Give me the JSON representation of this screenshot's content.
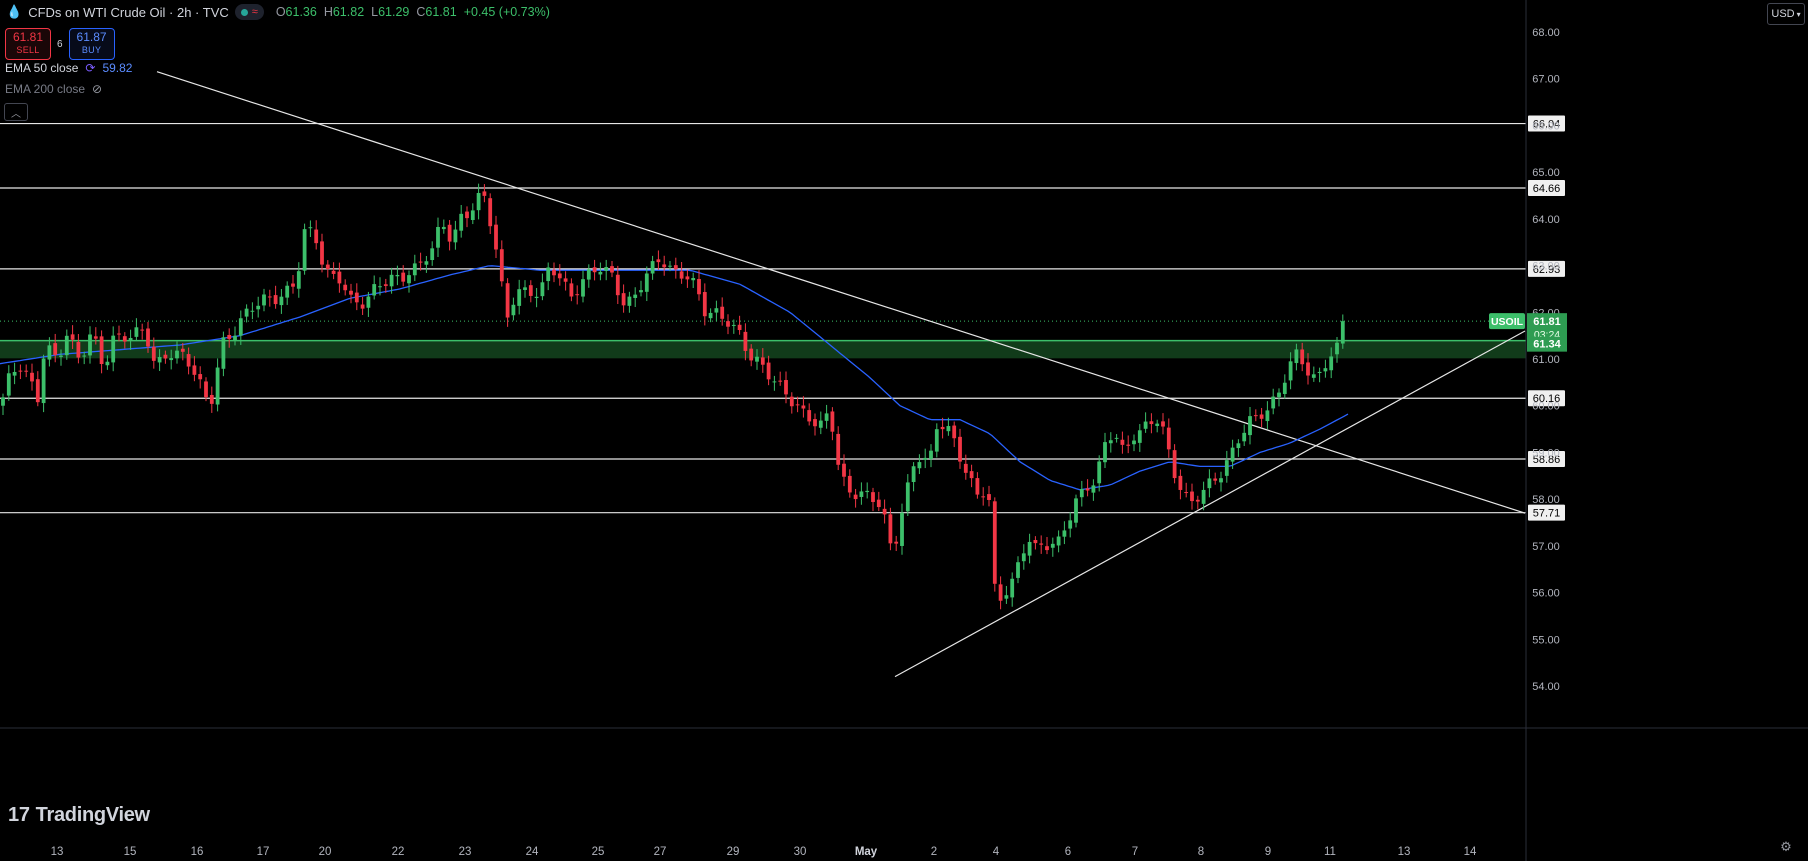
{
  "header": {
    "symbol_title": "CFDs on WTI Crude Oil · 2h · TVC",
    "ohlc": {
      "o_label": "O",
      "o": "61.36",
      "h_label": "H",
      "h": "61.82",
      "l_label": "L",
      "l": "61.29",
      "c_label": "C",
      "c": "61.81",
      "change": "+0.45 (+0.73%)"
    }
  },
  "trade": {
    "sell_price": "61.81",
    "sell_label": "SELL",
    "spread": "6",
    "buy_price": "61.87",
    "buy_label": "BUY"
  },
  "indicators": [
    {
      "name": "EMA 50 close",
      "value": "59.82"
    },
    {
      "name": "EMA 200 close"
    }
  ],
  "currency": "USD",
  "brand": "TradingView",
  "colors": {
    "up": "#3cbf6a",
    "down": "#f23645",
    "ema50": "#2962ff",
    "support_zone": "#1f6b2f",
    "lines": "#e6e6e6"
  },
  "chart_data": {
    "type": "candlestick",
    "symbol": "USOIL",
    "timeframe": "2h",
    "ylim": [
      53.8,
      68.5
    ],
    "price_axis_ticks": [
      "54.00",
      "55.00",
      "56.00",
      "57.00",
      "58.00",
      "59.00",
      "60.00",
      "61.00",
      "62.00",
      "63.00",
      "64.00",
      "65.00",
      "66.00",
      "67.00",
      "68.00"
    ],
    "x_labels": [
      "13",
      "15",
      "16",
      "17",
      "20",
      "22",
      "23",
      "24",
      "25",
      "27",
      "29",
      "30",
      "May",
      "2",
      "4",
      "6",
      "7",
      "8",
      "9",
      "11",
      "13",
      "14"
    ],
    "horizontal_levels": [
      "66.04",
      "64.66",
      "62.93",
      "60.16",
      "58.86",
      "57.71"
    ],
    "support_zone": {
      "from": 61.1,
      "to": 61.35,
      "label": "61.34"
    },
    "last_price": {
      "symbol": "USOIL",
      "price": "61.81",
      "countdown": "03:24"
    },
    "close_path": [
      [
        0,
        60.0
      ],
      [
        10,
        60.6
      ],
      [
        22,
        60.8
      ],
      [
        38,
        60.2
      ],
      [
        45,
        61.4
      ],
      [
        58,
        61.0
      ],
      [
        66,
        61.5
      ],
      [
        80,
        60.9
      ],
      [
        92,
        61.6
      ],
      [
        104,
        60.9
      ],
      [
        114,
        61.5
      ],
      [
        130,
        61.4
      ],
      [
        145,
        61.6
      ],
      [
        155,
        60.9
      ],
      [
        168,
        61.2
      ],
      [
        185,
        61.0
      ],
      [
        198,
        60.5
      ],
      [
        210,
        60.0
      ],
      [
        222,
        61.4
      ],
      [
        235,
        61.6
      ],
      [
        250,
        62.0
      ],
      [
        265,
        62.3
      ],
      [
        280,
        62.4
      ],
      [
        296,
        62.6
      ],
      [
        305,
        63.7
      ],
      [
        315,
        63.6
      ],
      [
        325,
        62.9
      ],
      [
        340,
        62.8
      ],
      [
        352,
        62.2
      ],
      [
        365,
        62.1
      ],
      [
        378,
        62.6
      ],
      [
        392,
        62.8
      ],
      [
        405,
        62.8
      ],
      [
        418,
        62.9
      ],
      [
        432,
        63.3
      ],
      [
        442,
        64.0
      ],
      [
        452,
        63.6
      ],
      [
        462,
        64.1
      ],
      [
        470,
        64.1
      ],
      [
        483,
        64.5
      ],
      [
        493,
        63.7
      ],
      [
        500,
        62.9
      ],
      [
        506,
        61.9
      ],
      [
        516,
        62.5
      ],
      [
        528,
        62.4
      ],
      [
        540,
        62.3
      ],
      [
        550,
        63.0
      ],
      [
        560,
        62.8
      ],
      [
        572,
        62.4
      ],
      [
        585,
        62.7
      ],
      [
        598,
        62.9
      ],
      [
        612,
        62.8
      ],
      [
        625,
        62.2
      ],
      [
        635,
        62.4
      ],
      [
        645,
        62.7
      ],
      [
        660,
        63.1
      ],
      [
        672,
        62.9
      ],
      [
        685,
        62.9
      ],
      [
        695,
        62.6
      ],
      [
        706,
        61.9
      ],
      [
        718,
        61.9
      ],
      [
        730,
        61.8
      ],
      [
        740,
        61.6
      ],
      [
        750,
        61.1
      ],
      [
        762,
        60.8
      ],
      [
        772,
        60.5
      ],
      [
        785,
        60.3
      ],
      [
        795,
        60.1
      ],
      [
        808,
        59.8
      ],
      [
        820,
        59.5
      ],
      [
        830,
        59.8
      ],
      [
        840,
        58.5
      ],
      [
        850,
        58.2
      ],
      [
        862,
        58.2
      ],
      [
        872,
        58.0
      ],
      [
        882,
        57.8
      ],
      [
        890,
        56.9
      ],
      [
        896,
        57.1
      ],
      [
        904,
        58.0
      ],
      [
        914,
        58.8
      ],
      [
        920,
        59.0
      ],
      [
        930,
        58.8
      ],
      [
        938,
        59.6
      ],
      [
        950,
        59.4
      ],
      [
        958,
        59.0
      ],
      [
        968,
        58.6
      ],
      [
        978,
        58.1
      ],
      [
        988,
        58.3
      ],
      [
        996,
        55.6
      ],
      [
        1004,
        55.9
      ],
      [
        1012,
        56.2
      ],
      [
        1020,
        56.7
      ],
      [
        1028,
        57.3
      ],
      [
        1036,
        57.0
      ],
      [
        1048,
        57.0
      ],
      [
        1060,
        57.0
      ],
      [
        1068,
        57.5
      ],
      [
        1076,
        58.0
      ],
      [
        1086,
        58.3
      ],
      [
        1096,
        58.5
      ],
      [
        1104,
        59.1
      ],
      [
        1114,
        59.4
      ],
      [
        1124,
        58.9
      ],
      [
        1134,
        59.4
      ],
      [
        1144,
        59.6
      ],
      [
        1156,
        59.8
      ],
      [
        1164,
        59.4
      ],
      [
        1172,
        58.6
      ],
      [
        1180,
        58.2
      ],
      [
        1190,
        57.9
      ],
      [
        1200,
        58.2
      ],
      [
        1210,
        58.4
      ],
      [
        1220,
        58.5
      ],
      [
        1230,
        58.8
      ],
      [
        1240,
        59.3
      ],
      [
        1250,
        59.7
      ],
      [
        1260,
        59.9
      ],
      [
        1270,
        60.0
      ],
      [
        1280,
        60.3
      ],
      [
        1290,
        60.8
      ],
      [
        1298,
        61.1
      ],
      [
        1306,
        60.8
      ],
      [
        1316,
        60.6
      ],
      [
        1326,
        61.0
      ],
      [
        1336,
        61.2
      ],
      [
        1342,
        61.2
      ],
      [
        1348,
        61.81
      ]
    ],
    "ema50_path": [
      [
        0,
        60.9
      ],
      [
        60,
        61.1
      ],
      [
        120,
        61.2
      ],
      [
        180,
        61.3
      ],
      [
        240,
        61.5
      ],
      [
        300,
        61.9
      ],
      [
        350,
        62.3
      ],
      [
        400,
        62.5
      ],
      [
        450,
        62.8
      ],
      [
        490,
        63.0
      ],
      [
        540,
        62.9
      ],
      [
        600,
        62.9
      ],
      [
        650,
        62.9
      ],
      [
        690,
        62.9
      ],
      [
        740,
        62.6
      ],
      [
        790,
        62.0
      ],
      [
        830,
        61.3
      ],
      [
        870,
        60.6
      ],
      [
        900,
        60.0
      ],
      [
        930,
        59.7
      ],
      [
        960,
        59.7
      ],
      [
        990,
        59.4
      ],
      [
        1020,
        58.8
      ],
      [
        1050,
        58.4
      ],
      [
        1080,
        58.2
      ],
      [
        1110,
        58.3
      ],
      [
        1140,
        58.6
      ],
      [
        1170,
        58.8
      ],
      [
        1200,
        58.7
      ],
      [
        1230,
        58.7
      ],
      [
        1260,
        59.0
      ],
      [
        1290,
        59.2
      ],
      [
        1320,
        59.5
      ],
      [
        1348,
        59.82
      ]
    ],
    "trendlines": [
      {
        "name": "descending",
        "from": [
          157,
          67.15
        ],
        "to": [
          1525,
          57.7
        ]
      },
      {
        "name": "ascending",
        "from": [
          895,
          54.2
        ],
        "to": [
          1525,
          61.6
        ]
      }
    ]
  }
}
